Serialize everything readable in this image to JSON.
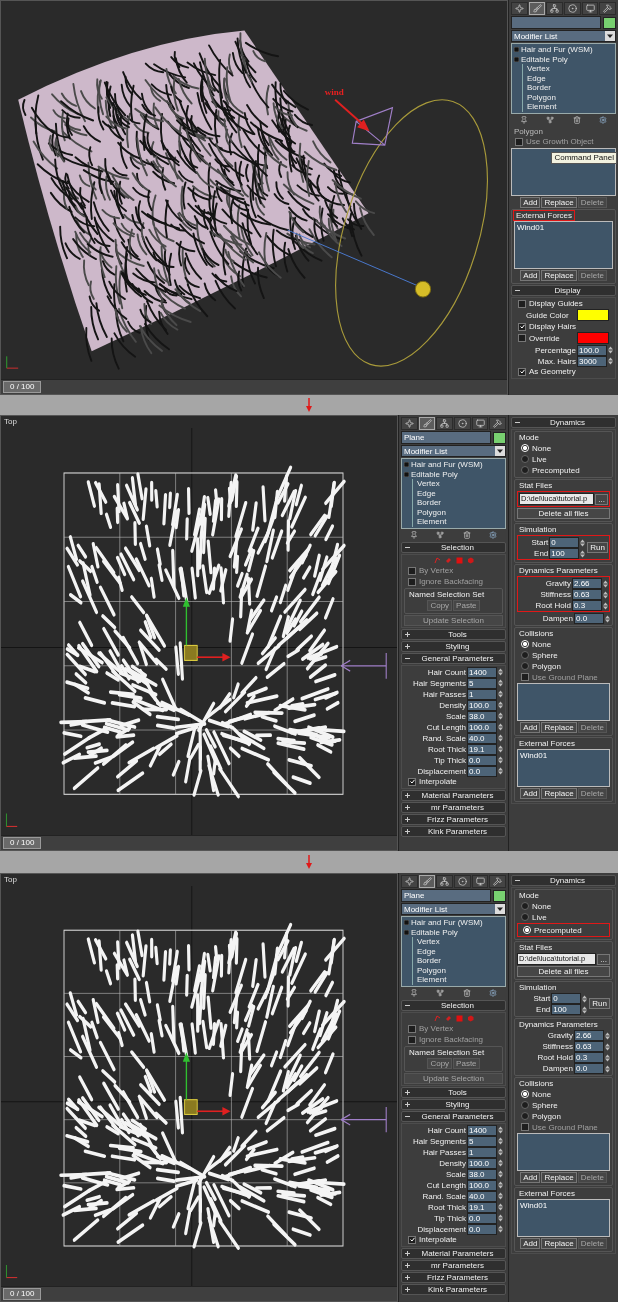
{
  "panels": [
    {
      "kind": "perspective",
      "annotation": "wind",
      "tooltip": "Command Panel",
      "timeline": {
        "label": "0 / 100",
        "level": 0
      },
      "columns": [
        {
          "tabs": [
            {
              "kind": "create",
              "selected": false
            },
            {
              "kind": "modify",
              "selected": true
            },
            {
              "kind": "hierarchy",
              "selected": false
            },
            {
              "kind": "motion",
              "selected": false
            },
            {
              "kind": "display",
              "selected": false
            },
            {
              "kind": "utilities",
              "selected": false
            }
          ],
          "modifier_list": "Modifier List",
          "stack": [
            {
              "label": "Hair and Fur (WSM)"
            },
            {
              "label": "Editable Poly",
              "children": [
                {
                  "label": "Vertex"
                },
                {
                  "label": "Edge"
                },
                {
                  "label": "Border"
                },
                {
                  "label": "Polygon"
                },
                {
                  "label": "Element"
                }
              ]
            }
          ],
          "items": [
            {
              "kind": "label",
              "label": "Polygon"
            },
            {
              "kind": "checkbox",
              "label": "Use Growth Object",
              "checked": false,
              "disabled": true
            },
            {
              "kind": "listbox"
            },
            {
              "kind": "buttons",
              "buttons": [
                {
                  "label": "Add",
                  "disabled": false
                },
                {
                  "label": "Replace",
                  "disabled": false
                },
                {
                  "label": "Delete",
                  "disabled": true
                }
              ]
            },
            {
              "kind": "group",
              "title": "External Forces",
              "highlighted": true,
              "items": [
                {
                  "kind": "listbox",
                  "entries": [
                    "Wind01"
                  ]
                },
                {
                  "kind": "buttons",
                  "buttons": [
                    {
                      "label": "Add",
                      "disabled": false
                    },
                    {
                      "label": "Replace",
                      "disabled": false
                    },
                    {
                      "label": "Delete",
                      "disabled": true
                    }
                  ]
                }
              ]
            },
            {
              "kind": "rollout",
              "title": "Display",
              "expanded": true,
              "items": [
                {
                  "kind": "checkbox",
                  "label": "Display Guides",
                  "checked": false,
                  "disabled": false
                },
                {
                  "kind": "color",
                  "label": "Guide Color",
                  "color": "#ffff00"
                },
                {
                  "kind": "checkbox",
                  "label": "Display Hairs",
                  "checked": true,
                  "disabled": false
                },
                {
                  "kind": "color",
                  "label": "Override",
                  "checked": false,
                  "color": "#ff0000"
                },
                {
                  "kind": "spinner",
                  "label": "Percentage",
                  "value": "100.0"
                },
                {
                  "kind": "spinner",
                  "label": "Max. Hairs",
                  "value": "3000"
                },
                {
                  "kind": "checkbox",
                  "label": "As Geometry",
                  "checked": true,
                  "disabled": false
                }
              ]
            }
          ]
        }
      ]
    },
    {
      "kind": "top",
      "viewport_label": "Top",
      "timeline": {
        "label": "0 / 100",
        "level": 0
      },
      "columns": [
        {
          "tabs": [
            {
              "kind": "create",
              "selected": false
            },
            {
              "kind": "modify",
              "selected": true
            },
            {
              "kind": "hierarchy",
              "selected": false
            },
            {
              "kind": "motion",
              "selected": false
            },
            {
              "kind": "display",
              "selected": false
            },
            {
              "kind": "utilities",
              "selected": false
            }
          ],
          "object_name": "Plane",
          "modifier_list": "Modifier List",
          "stack": [
            {
              "label": "Hair and Fur (WSM)"
            },
            {
              "label": "Editable Poly",
              "children": [
                {
                  "label": "Vertex"
                },
                {
                  "label": "Edge"
                },
                {
                  "label": "Border"
                },
                {
                  "label": "Polygon"
                },
                {
                  "label": "Element"
                }
              ]
            }
          ],
          "items": [
            {
              "kind": "rollout",
              "title": "Selection",
              "expanded": true,
              "items": [
                {
                  "kind": "selection_icons"
                },
                {
                  "kind": "checkbox",
                  "label": "By Vertex",
                  "checked": false,
                  "disabled": true
                },
                {
                  "kind": "checkbox",
                  "label": "Ignore Backfacing",
                  "checked": false,
                  "disabled": true
                },
                {
                  "kind": "group",
                  "title": "Named Selection Set",
                  "highlighted": false,
                  "items": [
                    {
                      "kind": "buttons",
                      "buttons": [
                        {
                          "label": "Copy",
                          "disabled": true
                        },
                        {
                          "label": "Paste",
                          "disabled": true
                        }
                      ]
                    }
                  ]
                },
                {
                  "kind": "button",
                  "label": "Update Selection",
                  "disabled": true
                }
              ]
            },
            {
              "kind": "rollout",
              "title": "Tools",
              "expanded": false
            },
            {
              "kind": "rollout",
              "title": "Styling",
              "expanded": false
            },
            {
              "kind": "rollout",
              "title": "General Parameters",
              "expanded": true,
              "items": [
                {
                  "kind": "spinner",
                  "label": "Hair Count",
                  "value": "1400"
                },
                {
                  "kind": "spinner",
                  "label": "Hair Segments",
                  "value": "5"
                },
                {
                  "kind": "spinner",
                  "label": "Hair Passes",
                  "value": "1"
                },
                {
                  "kind": "spinner",
                  "label": "Density",
                  "value": "100.0"
                },
                {
                  "kind": "spinner",
                  "label": "Scale",
                  "value": "38.0"
                },
                {
                  "kind": "spinner",
                  "label": "Cut Length",
                  "value": "100.0"
                },
                {
                  "kind": "spinner",
                  "label": "Rand. Scale",
                  "value": "40.0"
                },
                {
                  "kind": "spinner",
                  "label": "Root Thick",
                  "value": "19.1"
                },
                {
                  "kind": "spinner",
                  "label": "Tip Thick",
                  "value": "0.0"
                },
                {
                  "kind": "spinner",
                  "label": "Displacement",
                  "value": "0.0"
                },
                {
                  "kind": "checkbox",
                  "label": "Interpolate",
                  "checked": true,
                  "disabled": false
                }
              ]
            },
            {
              "kind": "rollout",
              "title": "Material Parameters",
              "expanded": false
            },
            {
              "kind": "rollout",
              "title": "mr Parameters",
              "expanded": false
            },
            {
              "kind": "rollout",
              "title": "Frizz Parameters",
              "expanded": false
            },
            {
              "kind": "rollout",
              "title": "Kink Parameters",
              "expanded": false
            }
          ]
        },
        {
          "items": [
            {
              "kind": "rollout",
              "title": "Dynamics",
              "expanded": true,
              "items": [
                {
                  "kind": "group",
                  "title": "Mode",
                  "highlighted": false,
                  "items": [
                    {
                      "kind": "radio",
                      "label": "None",
                      "selected": true
                    },
                    {
                      "kind": "radio",
                      "label": "Live",
                      "selected": false
                    },
                    {
                      "kind": "radio",
                      "label": "Precomputed",
                      "selected": false
                    }
                  ]
                },
                {
                  "kind": "group",
                  "title": "Stat Files",
                  "highlighted": false,
                  "items": [
                    {
                      "kind": "frame",
                      "items": [
                        {
                          "kind": "file_field",
                          "value": "D:\\del\\luca\\tutorial.p",
                          "button": "..."
                        }
                      ]
                    },
                    {
                      "kind": "button",
                      "label": "Delete all files",
                      "disabled": false
                    }
                  ]
                },
                {
                  "kind": "group",
                  "title": "Simulation",
                  "highlighted": false,
                  "items": [
                    {
                      "kind": "frame",
                      "items": [
                        {
                          "kind": "simulation",
                          "spinners": [
                            {
                              "label": "Start",
                              "value": "0"
                            },
                            {
                              "label": "End",
                              "value": "100"
                            }
                          ],
                          "button": "Run"
                        }
                      ]
                    }
                  ]
                },
                {
                  "kind": "group",
                  "title": "Dynamics Parameters",
                  "highlighted": false,
                  "items": [
                    {
                      "kind": "frame",
                      "items": [
                        {
                          "kind": "spinner",
                          "label": "Gravity",
                          "value": "2.66"
                        },
                        {
                          "kind": "spinner",
                          "label": "Stiffness",
                          "value": "0.63"
                        },
                        {
                          "kind": "spinner",
                          "label": "Root Hold",
                          "value": "0.3"
                        }
                      ]
                    },
                    {
                      "kind": "spinner",
                      "label": "Dampen",
                      "value": "0.0"
                    }
                  ]
                },
                {
                  "kind": "group",
                  "title": "Collisions",
                  "highlighted": false,
                  "items": [
                    {
                      "kind": "radio",
                      "label": "None",
                      "selected": true
                    },
                    {
                      "kind": "radio",
                      "label": "Sphere",
                      "selected": false
                    },
                    {
                      "kind": "radio",
                      "label": "Polygon",
                      "selected": false
                    },
                    {
                      "kind": "checkbox",
                      "label": "Use Ground Plane",
                      "checked": false,
                      "disabled": true
                    },
                    {
                      "kind": "listbox"
                    },
                    {
                      "kind": "buttons",
                      "buttons": [
                        {
                          "label": "Add",
                          "disabled": false
                        },
                        {
                          "label": "Replace",
                          "disabled": false
                        },
                        {
                          "label": "Delete",
                          "disabled": true
                        }
                      ]
                    }
                  ]
                },
                {
                  "kind": "group",
                  "title": "External Forces",
                  "highlighted": false,
                  "items": [
                    {
                      "kind": "listbox",
                      "entries": [
                        "Wind01"
                      ]
                    },
                    {
                      "kind": "buttons",
                      "buttons": [
                        {
                          "label": "Add",
                          "disabled": false
                        },
                        {
                          "label": "Replace",
                          "disabled": false
                        },
                        {
                          "label": "Delete",
                          "disabled": true
                        }
                      ]
                    }
                  ]
                }
              ]
            }
          ]
        }
      ]
    },
    {
      "kind": "top",
      "viewport_label": "Top",
      "timeline": {
        "label": "0 / 100",
        "level": 0
      },
      "columns": [
        {
          "tabs": [
            {
              "kind": "create",
              "selected": false
            },
            {
              "kind": "modify",
              "selected": true
            },
            {
              "kind": "hierarchy",
              "selected": false
            },
            {
              "kind": "motion",
              "selected": false
            },
            {
              "kind": "display",
              "selected": false
            },
            {
              "kind": "utilities",
              "selected": false
            }
          ],
          "object_name": "Plane",
          "modifier_list": "Modifier List",
          "stack": [
            {
              "label": "Hair and Fur (WSM)"
            },
            {
              "label": "Editable Poly",
              "children": [
                {
                  "label": "Vertex"
                },
                {
                  "label": "Edge"
                },
                {
                  "label": "Border"
                },
                {
                  "label": "Polygon"
                },
                {
                  "label": "Element"
                }
              ]
            }
          ],
          "items": [
            {
              "kind": "rollout",
              "title": "Selection",
              "expanded": true,
              "items": [
                {
                  "kind": "selection_icons"
                },
                {
                  "kind": "checkbox",
                  "label": "By Vertex",
                  "checked": false,
                  "disabled": true
                },
                {
                  "kind": "checkbox",
                  "label": "Ignore Backfacing",
                  "checked": false,
                  "disabled": true
                },
                {
                  "kind": "group",
                  "title": "Named Selection Set",
                  "highlighted": false,
                  "items": [
                    {
                      "kind": "buttons",
                      "buttons": [
                        {
                          "label": "Copy",
                          "disabled": true
                        },
                        {
                          "label": "Paste",
                          "disabled": true
                        }
                      ]
                    }
                  ]
                },
                {
                  "kind": "button",
                  "label": "Update Selection",
                  "disabled": true
                }
              ]
            },
            {
              "kind": "rollout",
              "title": "Tools",
              "expanded": false
            },
            {
              "kind": "rollout",
              "title": "Styling",
              "expanded": false
            },
            {
              "kind": "rollout",
              "title": "General Parameters",
              "expanded": true,
              "items": [
                {
                  "kind": "spinner",
                  "label": "Hair Count",
                  "value": "1400"
                },
                {
                  "kind": "spinner",
                  "label": "Hair Segments",
                  "value": "5"
                },
                {
                  "kind": "spinner",
                  "label": "Hair Passes",
                  "value": "1"
                },
                {
                  "kind": "spinner",
                  "label": "Density",
                  "value": "100.0"
                },
                {
                  "kind": "spinner",
                  "label": "Scale",
                  "value": "38.0"
                },
                {
                  "kind": "spinner",
                  "label": "Cut Length",
                  "value": "100.0"
                },
                {
                  "kind": "spinner",
                  "label": "Rand. Scale",
                  "value": "40.0"
                },
                {
                  "kind": "spinner",
                  "label": "Root Thick",
                  "value": "19.1"
                },
                {
                  "kind": "spinner",
                  "label": "Tip Thick",
                  "value": "0.0"
                },
                {
                  "kind": "spinner",
                  "label": "Displacement",
                  "value": "0.0"
                },
                {
                  "kind": "checkbox",
                  "label": "Interpolate",
                  "checked": true,
                  "disabled": false
                }
              ]
            },
            {
              "kind": "rollout",
              "title": "Material Parameters",
              "expanded": false
            },
            {
              "kind": "rollout",
              "title": "mr Parameters",
              "expanded": false
            },
            {
              "kind": "rollout",
              "title": "Frizz Parameters",
              "expanded": false
            },
            {
              "kind": "rollout",
              "title": "Kink Parameters",
              "expanded": false
            }
          ]
        },
        {
          "items": [
            {
              "kind": "rollout",
              "title": "Dynamics",
              "expanded": true,
              "items": [
                {
                  "kind": "group",
                  "title": "Mode",
                  "highlighted": false,
                  "items": [
                    {
                      "kind": "radio",
                      "label": "None",
                      "selected": false
                    },
                    {
                      "kind": "radio",
                      "label": "Live",
                      "selected": false
                    },
                    {
                      "kind": "frame",
                      "items": [
                        {
                          "kind": "radio",
                          "label": "Precomputed",
                          "selected": true
                        }
                      ]
                    }
                  ]
                },
                {
                  "kind": "group",
                  "title": "Stat Files",
                  "highlighted": false,
                  "items": [
                    {
                      "kind": "file_field",
                      "value": "D:\\del\\luca\\tutorial.p",
                      "button": "..."
                    },
                    {
                      "kind": "button",
                      "label": "Delete all files",
                      "disabled": false
                    }
                  ]
                },
                {
                  "kind": "group",
                  "title": "Simulation",
                  "highlighted": false,
                  "items": [
                    {
                      "kind": "simulation",
                      "spinners": [
                        {
                          "label": "Start",
                          "value": "0"
                        },
                        {
                          "label": "End",
                          "value": "100"
                        }
                      ],
                      "button": "Run"
                    }
                  ]
                },
                {
                  "kind": "group",
                  "title": "Dynamics Parameters",
                  "highlighted": false,
                  "items": [
                    {
                      "kind": "spinner",
                      "label": "Gravity",
                      "value": "2.66"
                    },
                    {
                      "kind": "spinner",
                      "label": "Stiffness",
                      "value": "0.63"
                    },
                    {
                      "kind": "spinner",
                      "label": "Root Hold",
                      "value": "0.3"
                    },
                    {
                      "kind": "spinner",
                      "label": "Dampen",
                      "value": "0.0"
                    }
                  ]
                },
                {
                  "kind": "group",
                  "title": "Collisions",
                  "highlighted": false,
                  "items": [
                    {
                      "kind": "radio",
                      "label": "None",
                      "selected": true
                    },
                    {
                      "kind": "radio",
                      "label": "Sphere",
                      "selected": false
                    },
                    {
                      "kind": "radio",
                      "label": "Polygon",
                      "selected": false
                    },
                    {
                      "kind": "checkbox",
                      "label": "Use Ground Plane",
                      "checked": false,
                      "disabled": true
                    },
                    {
                      "kind": "listbox"
                    },
                    {
                      "kind": "buttons",
                      "buttons": [
                        {
                          "label": "Add",
                          "disabled": false
                        },
                        {
                          "label": "Replace",
                          "disabled": false
                        },
                        {
                          "label": "Delete",
                          "disabled": true
                        }
                      ]
                    }
                  ]
                },
                {
                  "kind": "group",
                  "title": "External Forces",
                  "highlighted": false,
                  "items": [
                    {
                      "kind": "listbox",
                      "entries": [
                        "Wind01"
                      ]
                    },
                    {
                      "kind": "buttons",
                      "buttons": [
                        {
                          "label": "Add",
                          "disabled": false
                        },
                        {
                          "label": "Replace",
                          "disabled": false
                        },
                        {
                          "label": "Delete",
                          "disabled": true
                        }
                      ]
                    }
                  ]
                }
              ]
            }
          ]
        }
      ]
    }
  ]
}
